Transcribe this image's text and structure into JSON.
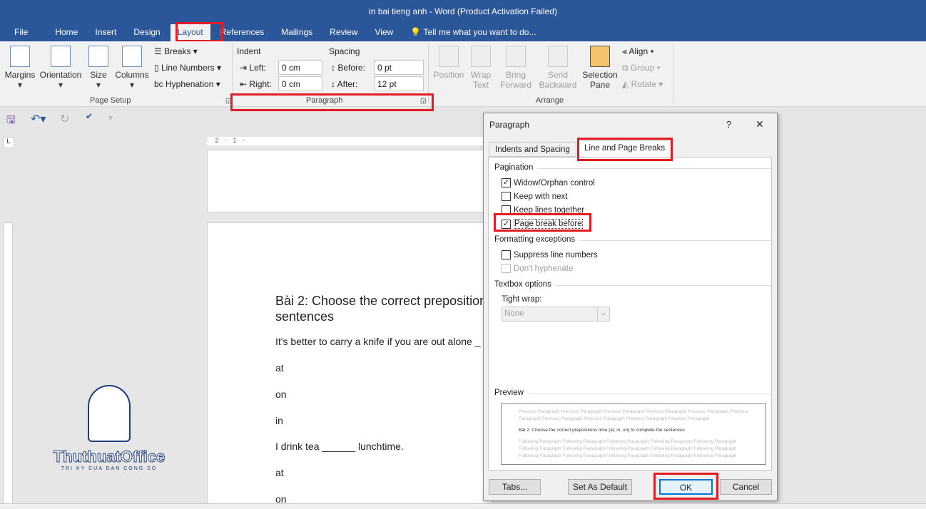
{
  "window": {
    "title": "in bai tieng anh - Word (Product Activation Failed)"
  },
  "menu_tabs": [
    "File",
    "Home",
    "Insert",
    "Design",
    "Layout",
    "References",
    "Mailings",
    "Review",
    "View"
  ],
  "tell_me": "Tell me what you want to do...",
  "ribbon": {
    "page_setup": {
      "label": "Page Setup",
      "margins": "Margins",
      "orientation": "Orientation",
      "size": "Size",
      "columns": "Columns",
      "breaks": "Breaks",
      "line_numbers": "Line Numbers",
      "hyphenation": "Hyphenation"
    },
    "paragraph": {
      "label": "Paragraph",
      "indent": "Indent",
      "spacing": "Spacing",
      "left": "Left:",
      "right": "Right:",
      "before": "Before:",
      "after": "After:",
      "left_value": "0 cm",
      "right_value": "0 cm",
      "before_value": "0 pt",
      "after_value": "12 pt"
    },
    "arrange": {
      "label": "Arrange",
      "position": "Position",
      "wrap_text": "Wrap Text",
      "bring_forward": "Bring Forward",
      "send_backward": "Send Backward",
      "selection_pane": "Selection Pane",
      "align": "Align",
      "group": "Group",
      "rotate": "Rotate"
    }
  },
  "document": {
    "heading": "Bài 2: Choose the correct preposition",
    "heading2": "sentences",
    "lines": [
      "It's better to carry a knife if you are out alone _",
      "at",
      "on",
      "in",
      "I drink tea ______ lunchtime.",
      "at",
      "on"
    ]
  },
  "ruler": "· 2 · 1 ·",
  "logo": {
    "name": "ThuthuatOffice",
    "tagline": "TRI KY CUA DAN CONG SO"
  },
  "dialog": {
    "title": "Paragraph",
    "help": "?",
    "close": "✕",
    "tabs": [
      "Indents and Spacing",
      "Line and Page Breaks"
    ],
    "pagination": "Pagination",
    "options": [
      {
        "label": "Widow/Orphan control",
        "checked": true
      },
      {
        "label": "Keep with next",
        "checked": false
      },
      {
        "label": "Keep lines together",
        "checked": false
      },
      {
        "label": "Page break before",
        "checked": true
      }
    ],
    "formatting_exceptions": "Formatting exceptions",
    "exceptions": [
      {
        "label": "Suppress line numbers",
        "checked": false
      },
      {
        "label": "Don't hyphenate",
        "checked": false,
        "disabled": true
      }
    ],
    "textbox_options": "Textbox options",
    "tight_wrap": "Tight wrap:",
    "tight_wrap_value": "None",
    "preview": "Preview",
    "preview_prev": "Previous Paragraph Previous Paragraph Previous Paragraph Previous Paragraph Previous Paragraph Previous Paragraph Previous Paragraph Previous Paragraph Previous Paragraph Previous Paragraph",
    "preview_current": "Bài 2: Choose the correct prepositions time (at, in, on) to complete the sentences",
    "preview_next": "Following Paragraph Following Paragraph Following Paragraph Following Paragraph Following Paragraph Following Paragraph Following Paragraph Following Paragraph Following Paragraph Following Paragraph Following Paragraph Following Paragraph Following Paragraph Following Paragraph Following Paragraph",
    "buttons": {
      "tabs": "Tabs...",
      "set_default": "Set As Default",
      "ok": "OK",
      "cancel": "Cancel"
    }
  },
  "colors": {
    "accent": "#2b579a",
    "highlight": "#e31b23"
  }
}
